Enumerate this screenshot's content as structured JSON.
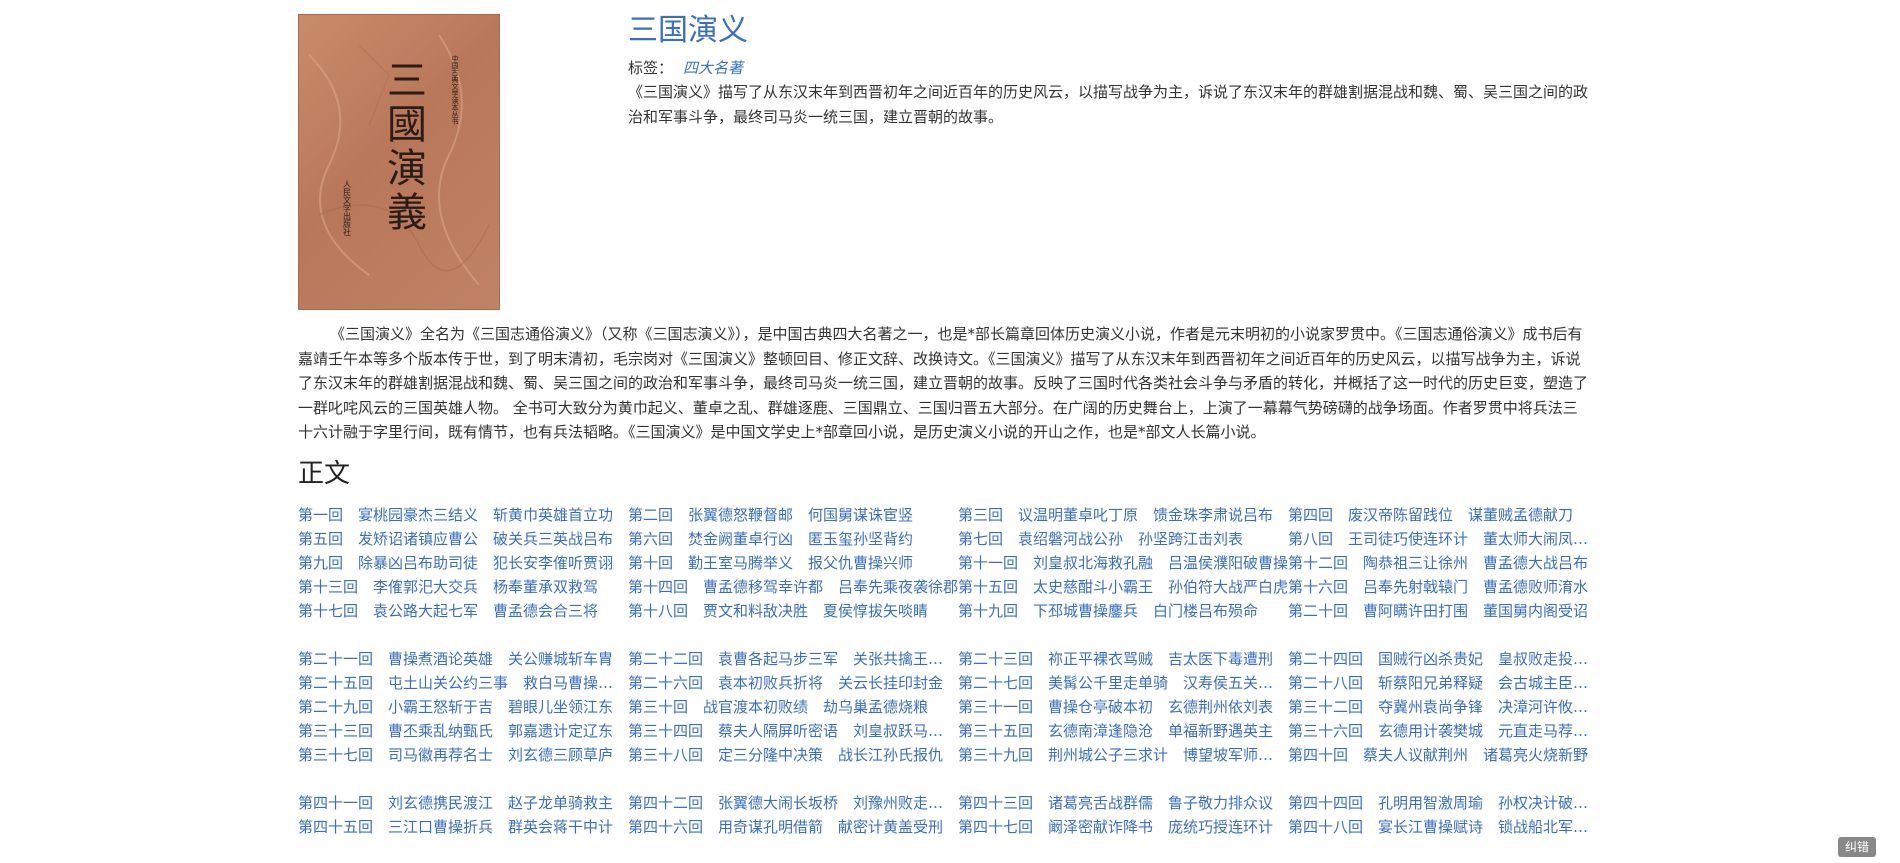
{
  "book": {
    "title": "三国演义",
    "tag_label": "标签：",
    "tag": "四大名著",
    "summary": "《三国演义》描写了从东汉末年到西晋初年之间近百年的历史风云，以描写战争为主，诉说了东汉末年的群雄割据混战和魏、蜀、吴三国之间的政治和军事斗争，最终司马炎一统三国，建立晋朝的故事。",
    "intro": "《三国演义》全名为《三国志通俗演义》（又称《三国志演义》），是中国古典四大名著之一，也是*部长篇章回体历史演义小说，作者是元末明初的小说家罗贯中。《三国志通俗演义》成书后有嘉靖壬午本等多个版本传于世，到了明末清初，毛宗岗对《三国演义》整顿回目、修正文辞、改换诗文。《三国演义》描写了从东汉末年到西晋初年之间近百年的历史风云，以描写战争为主，诉说了东汉末年的群雄割据混战和魏、蜀、吴三国之间的政治和军事斗争，最终司马炎一统三国，建立晋朝的故事。反映了三国时代各类社会斗争与矛盾的转化，并概括了这一时代的历史巨变，塑造了一群叱咤风云的三国英雄人物。 全书可大致分为黄巾起义、董卓之乱、群雄逐鹿、三国鼎立、三国归晋五大部分。在广阔的历史舞台上，上演了一幕幕气势磅礴的战争场面。作者罗贯中将兵法三十六计融于字里行间，既有情节，也有兵法韬略。《三国演义》是中国文学史上*部章回小说，是历史演义小说的开山之作，也是*部文人长篇小说。",
    "cover": {
      "big_title": "三國演義",
      "series": "中国古典文学读本丛书",
      "publisher": "人民文学出版社"
    }
  },
  "section_title": "正文",
  "chapter_groups": [
    {
      "rows": [
        [
          "第一回　宴桃园豪杰三结义　斩黄巾英雄首立功",
          "第二回　张翼德怒鞭督邮　何国舅谋诛宦竖",
          "第三回　议温明董卓叱丁原　馈金珠李肃说吕布",
          "第四回　废汉帝陈留践位　谋董贼孟德献刀"
        ],
        [
          "第五回　发矫诏诸镇应曹公　破关兵三英战吕布",
          "第六回　焚金阙董卓行凶　匿玉玺孙坚背约",
          "第七回　袁绍磐河战公孙　孙坚跨江击刘表",
          "第八回　王司徒巧使连环计　董太师大闹凤仪亭"
        ],
        [
          "第九回　除暴凶吕布助司徒　犯长安李傕听贾诩",
          "第十回　勤王室马腾举义　报父仇曹操兴师",
          "第十一回　刘皇叔北海救孔融　吕温侯濮阳破曹操",
          "第十二回　陶恭祖三让徐州　曹孟德大战吕布"
        ],
        [
          "第十三回　李傕郭汜大交兵　杨奉董承双救驾",
          "第十四回　曹孟德移驾幸许都　吕奉先乘夜袭徐郡",
          "第十五回　太史慈酣斗小霸王　孙伯符大战严白虎",
          "第十六回　吕奉先射戟辕门　曹孟德败师淯水"
        ],
        [
          "第十七回　袁公路大起七军　曹孟德会合三将",
          "第十八回　贾文和料敌决胜　夏侯惇拔矢啖睛",
          "第十九回　下邳城曹操鏖兵　白门楼吕布殒命",
          "第二十回　曹阿瞒许田打围　董国舅内阁受诏"
        ]
      ]
    },
    {
      "rows": [
        [
          "第二十一回　曹操煮酒论英雄　关公赚城斩车胄",
          "第二十二回　袁曹各起马步三军　关张共擒王刘二将",
          "第二十三回　祢正平裸衣骂贼　吉太医下毒遭刑",
          "第二十四回　国贼行凶杀贵妃　皇叔败走投袁绍"
        ],
        [
          "第二十五回　屯土山关公约三事　救白马曹操解重围",
          "第二十六回　袁本初败兵折将　关云长挂印封金",
          "第二十七回　美髯公千里走单骑　汉寿侯五关斩六将",
          "第二十八回　斩蔡阳兄弟释疑　会古城主臣聚义"
        ],
        [
          "第二十九回　小霸王怒斩于吉　碧眼儿坐领江东",
          "第三十回　战官渡本初败绩　劫乌巢孟德烧粮",
          "第三十一回　曹操仓亭破本初　玄德荆州依刘表",
          "第三十二回　夺冀州袁尚争锋　决漳河许攸献计"
        ],
        [
          "第三十三回　曹丕乘乱纳甄氏　郭嘉遗计定辽东",
          "第三十四回　蔡夫人隔屏听密语　刘皇叔跃马过檀溪",
          "第三十五回　玄德南漳逢隐沧　单福新野遇英主",
          "第三十六回　玄德用计袭樊城　元直走马荐诸葛"
        ],
        [
          "第三十七回　司马徽再荐名士　刘玄德三顾草庐",
          "第三十八回　定三分隆中决策　战长江孙氏报仇",
          "第三十九回　荆州城公子三求计　博望坡军师初用兵",
          "第四十回　蔡夫人议献荆州　诸葛亮火烧新野"
        ]
      ]
    },
    {
      "rows": [
        [
          "第四十一回　刘玄德携民渡江　赵子龙单骑救主",
          "第四十二回　张翼德大闹长坂桥　刘豫州败走汉津口",
          "第四十三回　诸葛亮舌战群儒　鲁子敬力排众议",
          "第四十四回　孔明用智激周瑜　孙权决计破曹操"
        ],
        [
          "第四十五回　三江口曹操折兵　群英会蒋干中计",
          "第四十六回　用奇谋孔明借箭　献密计黄盖受刑",
          "第四十七回　阚泽密献诈降书　庞统巧授连环计",
          "第四十八回　宴长江曹操赋诗　锁战船北军用武"
        ]
      ]
    }
  ],
  "feedback_label": "纠错"
}
